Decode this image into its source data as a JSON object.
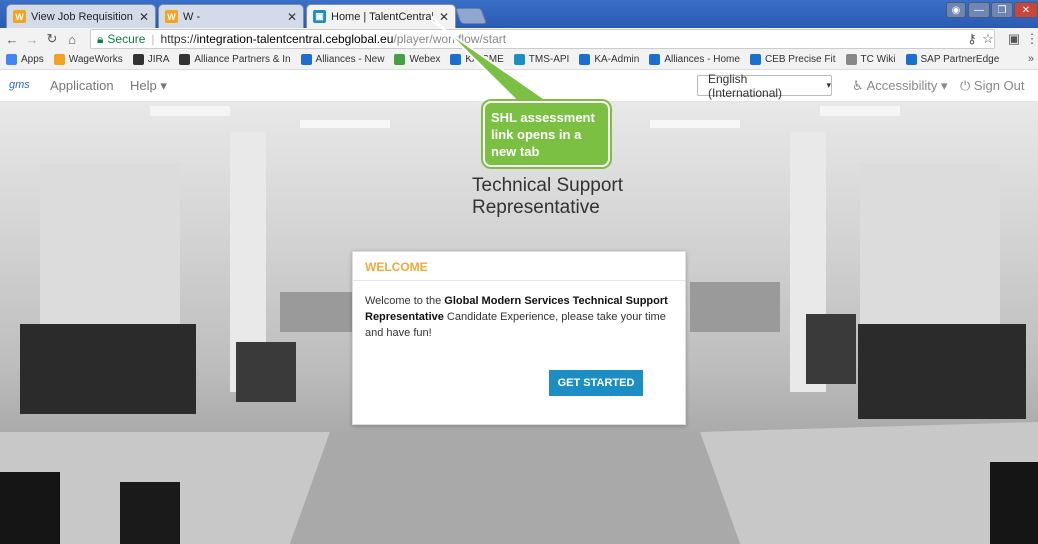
{
  "browser": {
    "tabs": [
      {
        "title": "View Job Requisition - W",
        "icon": "workday-icon",
        "icon_color": "#f4a21f",
        "active": false
      },
      {
        "title": "W -",
        "icon": "workday-icon",
        "icon_color": "#f4a21f",
        "active": false
      },
      {
        "title": "Home | TalentCentral-Ca",
        "icon": "talentcentral-icon",
        "icon_color": "#1c8ec4",
        "active": true
      }
    ],
    "address": {
      "secure_label": "Secure",
      "url_scheme": "https://",
      "url_host": "integration-talentcentral.cebglobal.eu",
      "url_path": "/player/workflow/start"
    },
    "bookmarks": [
      {
        "label": "Apps",
        "color": "#4285f4"
      },
      {
        "label": "WageWorks",
        "color": "#f4a21f"
      },
      {
        "label": "JIRA",
        "color": "#333333"
      },
      {
        "label": "Alliance Partners & In",
        "color": "#333333"
      },
      {
        "label": "Alliances - New",
        "color": "#1c6fd1"
      },
      {
        "label": "Webex",
        "color": "#43a047"
      },
      {
        "label": "KA-SME",
        "color": "#1c6fd1"
      },
      {
        "label": "TMS-API",
        "color": "#1c8ec4"
      },
      {
        "label": "KA-Admin",
        "color": "#1c6fd1"
      },
      {
        "label": "Alliances - Home",
        "color": "#1c6fd1"
      },
      {
        "label": "CEB Precise Fit",
        "color": "#1c6fd1"
      },
      {
        "label": "TC Wiki",
        "color": "#888888"
      },
      {
        "label": "SAP PartnerEdge",
        "color": "#1c6fd1"
      }
    ],
    "bookmarks_more": "»"
  },
  "header": {
    "logo": "gms",
    "menu_application": "Application",
    "menu_help": "Help ▾",
    "language": "English (International)",
    "language_caret": "▾",
    "accessibility": "Accessibility ▾",
    "sign_out": "Sign Out"
  },
  "main": {
    "job_title": "Technical Support Representative",
    "card": {
      "heading": "WELCOME",
      "text_before": "Welcome to the ",
      "text_bold": "Global Modern Services Technical Support Representative",
      "text_after": " Candidate Experience, please take your time and have fun!",
      "button": "GET STARTED"
    }
  },
  "annotation": {
    "callout_text": "SHL assessment link opens in a new tab",
    "color": "#7bc043"
  }
}
